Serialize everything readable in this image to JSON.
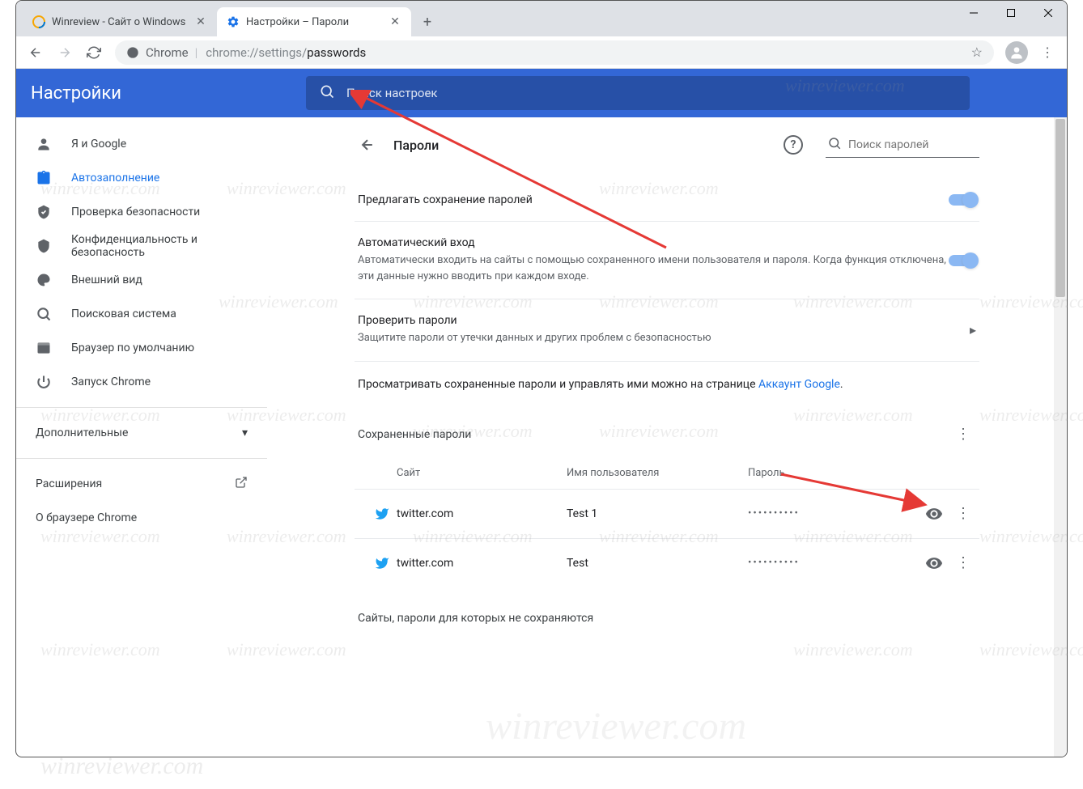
{
  "browser": {
    "tabs": [
      {
        "title": "Winreview - Сайт о Windows",
        "active": false
      },
      {
        "title": "Настройки – Пароли",
        "active": true
      }
    ],
    "url_secure_label": "Chrome",
    "url_path_prefix": "chrome://settings/",
    "url_path_suffix": "passwords"
  },
  "header": {
    "title": "Настройки",
    "search_placeholder": "Поиск настроек"
  },
  "sidebar": {
    "items": [
      {
        "label": "Я и Google",
        "icon": "person"
      },
      {
        "label": "Автозаполнение",
        "icon": "assignment",
        "active": true
      },
      {
        "label": "Проверка безопасности",
        "icon": "shield-check"
      },
      {
        "label": "Конфиденциальность и безопасность",
        "icon": "shield"
      },
      {
        "label": "Внешний вид",
        "icon": "palette"
      },
      {
        "label": "Поисковая система",
        "icon": "search"
      },
      {
        "label": "Браузер по умолчанию",
        "icon": "browser"
      },
      {
        "label": "Запуск Chrome",
        "icon": "power"
      }
    ],
    "advanced": "Дополнительные",
    "extensions": "Расширения",
    "about": "О браузере Chrome"
  },
  "page": {
    "title": "Пароли",
    "search_placeholder": "Поиск паролей",
    "offer_save": "Предлагать сохранение паролей",
    "auto_signin_title": "Автоматический вход",
    "auto_signin_desc": "Автоматически входить на сайты с помощью сохраненного имени пользователя и пароля. Когда функция отключена, эти данные нужно вводить при каждом входе.",
    "check_title": "Проверить пароли",
    "check_desc": "Защитите пароли от утечки данных и других проблем с безопасностью",
    "manage_text": "Просматривать сохраненные пароли и управлять ими можно на странице ",
    "manage_link": "Аккаунт Google",
    "saved_title": "Сохраненные пароли",
    "col_site": "Сайт",
    "col_user": "Имя пользователя",
    "col_pass": "Пароль",
    "rows": [
      {
        "site": "twitter.com",
        "user": "Test 1",
        "pass": "••••••••••"
      },
      {
        "site": "twitter.com",
        "user": "Test",
        "pass": "••••••••••"
      }
    ],
    "never_title": "Сайты, пароли для которых не сохраняются"
  },
  "watermark": "winreviewer.com"
}
